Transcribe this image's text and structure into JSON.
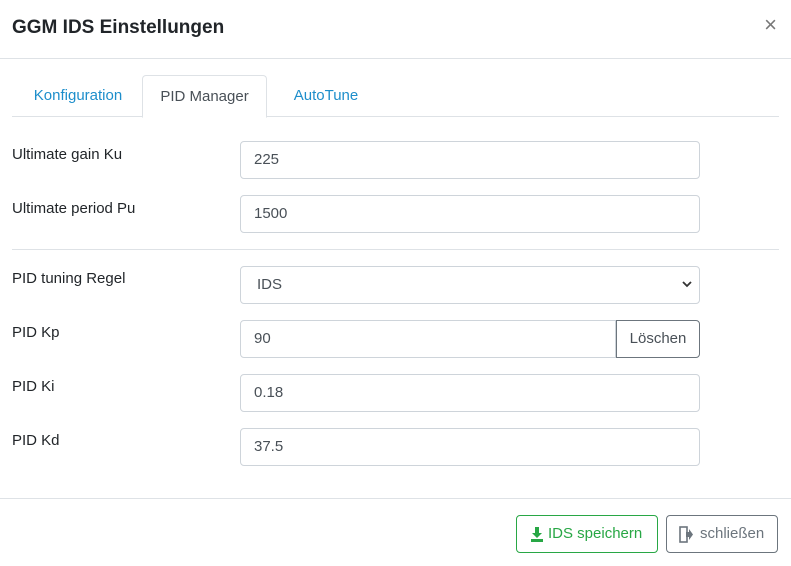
{
  "modal": {
    "title": "GGM IDS Einstellungen",
    "close_symbol": "×"
  },
  "tabs": [
    {
      "label": "Konfiguration",
      "active": false
    },
    {
      "label": "PID Manager",
      "active": true
    },
    {
      "label": "AutoTune",
      "active": false
    }
  ],
  "fields": {
    "ku": {
      "label": "Ultimate gain Ku",
      "value": "225"
    },
    "pu": {
      "label": "Ultimate period Pu",
      "value": "1500"
    },
    "rule": {
      "label": "PID tuning Regel",
      "value": "IDS",
      "arrow": "⌄"
    },
    "kp": {
      "label": "PID Kp",
      "value": "90",
      "clear_label": "Löschen"
    },
    "ki": {
      "label": "PID Ki",
      "value": "0.18"
    },
    "kd": {
      "label": "PID Kd",
      "value": "37.5"
    }
  },
  "footer": {
    "save_label": "IDS speichern",
    "save_icon": "download-icon",
    "close_label": "schließen",
    "close_icon": "sign-out-icon"
  },
  "colors": {
    "accent": "#1d8ecb",
    "success": "#28a745",
    "secondary": "#6c757d"
  }
}
